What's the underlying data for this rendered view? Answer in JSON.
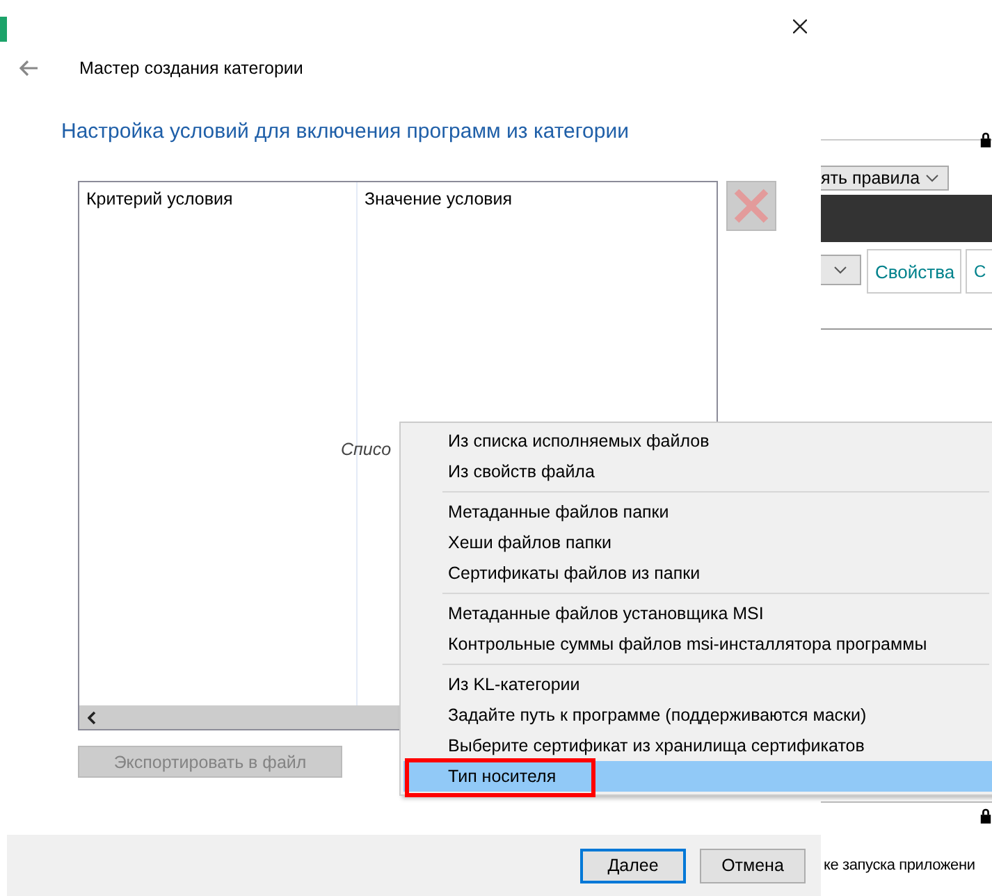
{
  "background_window": {
    "rules_dropdown": "ять правила",
    "properties_button": "Свойства",
    "second_button": "С",
    "status_text": "ке запуска приложени"
  },
  "dialog": {
    "header": "Мастер создания категории",
    "title": "Настройка условий для включения программ из категории",
    "table": {
      "columns": [
        "Критерий условия",
        "Значение условия"
      ],
      "empty_text": "Списо"
    },
    "delete_button": {
      "disabled": true
    },
    "export_button": {
      "label": "Экспортировать в файл",
      "disabled": true
    },
    "buttons": [
      {
        "label": "Далее",
        "default": true
      },
      {
        "label": "Отмена",
        "default": false
      }
    ]
  },
  "context_menu": {
    "groups": [
      {
        "items": [
          {
            "label": "Из списка исполняемых файлов",
            "selected": false,
            "marked": false
          },
          {
            "label": "Из свойств файла",
            "selected": false,
            "marked": false
          }
        ]
      },
      {
        "items": [
          {
            "label": "Метаданные файлов папки",
            "selected": false,
            "marked": false
          },
          {
            "label": "Хеши файлов папки",
            "selected": false,
            "marked": false
          },
          {
            "label": "Сертификаты файлов из папки",
            "selected": false,
            "marked": false
          }
        ]
      },
      {
        "items": [
          {
            "label": "Метаданные файлов установщика MSI",
            "selected": false,
            "marked": false
          },
          {
            "label": "Контрольные суммы файлов msi-инсталлятора программы",
            "selected": false,
            "marked": false
          }
        ]
      },
      {
        "items": [
          {
            "label": "Из KL-категории",
            "selected": false,
            "marked": false
          },
          {
            "label": "Задайте путь к программе (поддерживаются маски)",
            "selected": false,
            "marked": false
          },
          {
            "label": "Выберите сертификат из хранилища сертификатов",
            "selected": false,
            "marked": false
          },
          {
            "label": "Тип носителя",
            "selected": true,
            "marked": true
          }
        ]
      }
    ]
  }
}
